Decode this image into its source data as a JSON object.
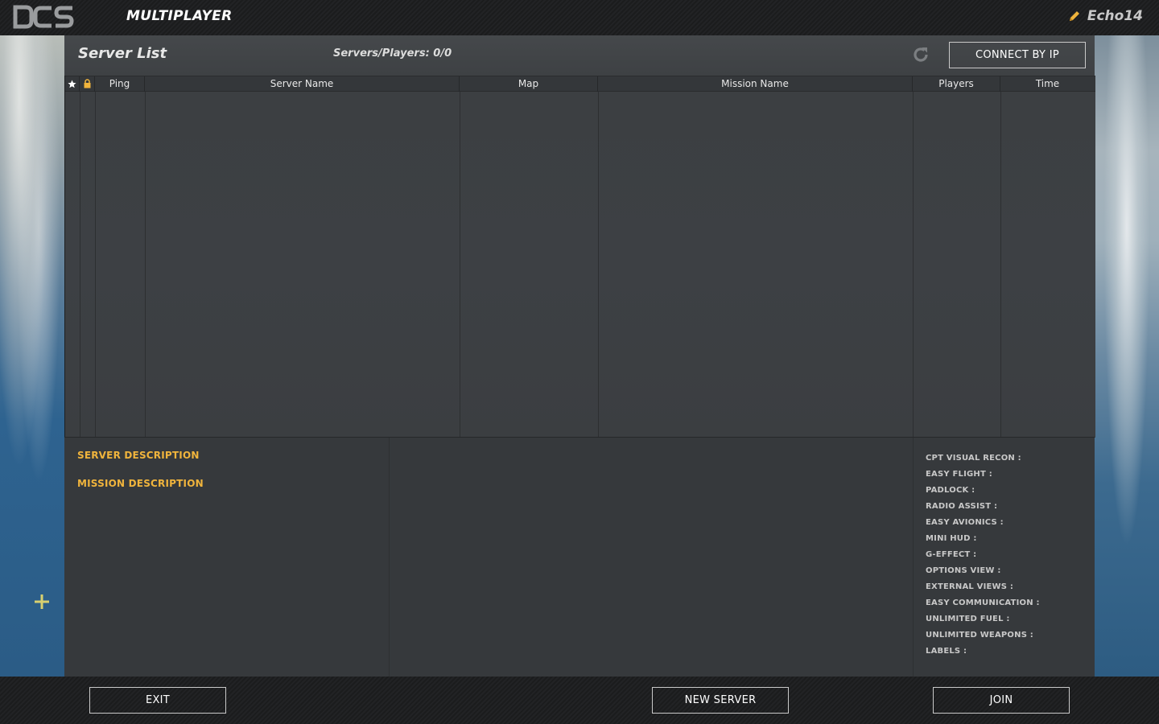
{
  "topbar": {
    "logo_text": "DCS",
    "title": "MULTIPLAYER",
    "user_name": "Echo14"
  },
  "panel": {
    "title": "Server List",
    "servers_players": "Servers/Players: 0/0",
    "connect_by_ip_label": "CONNECT BY IP"
  },
  "table": {
    "columns": [
      {
        "key": "favorite",
        "label": "",
        "icon": "star-icon"
      },
      {
        "key": "locked",
        "label": "",
        "icon": "lock-icon"
      },
      {
        "key": "ping",
        "label": "Ping"
      },
      {
        "key": "server_name",
        "label": "Server Name"
      },
      {
        "key": "map",
        "label": "Map"
      },
      {
        "key": "mission_name",
        "label": "Mission Name"
      },
      {
        "key": "players",
        "label": "Players"
      },
      {
        "key": "time",
        "label": "Time"
      }
    ],
    "rows": []
  },
  "info": {
    "server_description_label": "SERVER DESCRIPTION",
    "mission_description_label": "MISSION DESCRIPTION",
    "options": [
      "CPT VISUAL RECON :",
      "EASY FLIGHT :",
      "PADLOCK :",
      "RADIO ASSIST :",
      "EASY AVIONICS :",
      "MINI HUD :",
      "G-EFFECT :",
      "OPTIONS VIEW :",
      "EXTERNAL VIEWS :",
      "EASY COMMUNICATION :",
      "UNLIMITED FUEL :",
      "UNLIMITED WEAPONS :",
      "LABELS :"
    ]
  },
  "bottombar": {
    "exit_label": "EXIT",
    "new_server_label": "NEW SERVER",
    "join_label": "JOIN"
  },
  "colors": {
    "accent_orange": "#f0b43c",
    "panel_bg": "#3a3d40",
    "bar_bg": "#1f2022"
  }
}
